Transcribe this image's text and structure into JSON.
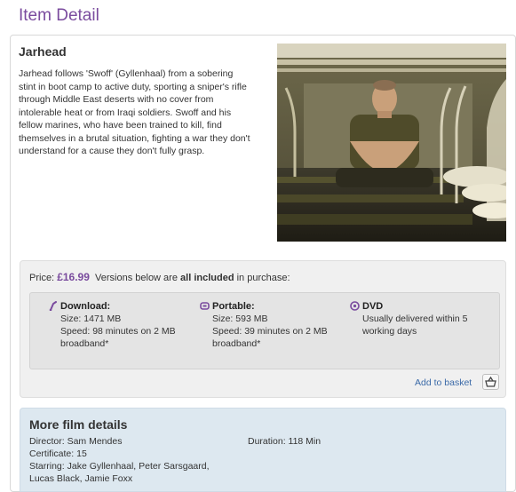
{
  "page": {
    "title": "Item Detail"
  },
  "film": {
    "title": "Jarhead",
    "synopsis": "Jarhead follows 'Swoff' (Gyllenhaal) from a sobering stint in boot camp to active duty, sporting a sniper's rifle through Middle East deserts with no cover from intolerable heat or from Iraqi soldiers. Swoff and his fellow marines, who have been trained to kill, find themselves in a brutal situation, fighting a war they don't understand for a cause they don't fully grasp."
  },
  "purchase": {
    "price_label": "Price:",
    "price_value": "£16.99",
    "versions_pre": "Versions below are",
    "versions_bold": "all included",
    "versions_post": "in purchase:",
    "versions": [
      {
        "icon": "download-icon",
        "title": "Download:",
        "line1": "Size: 1471 MB",
        "line2": "Speed: 98 minutes on 2 MB broadband*"
      },
      {
        "icon": "portable-icon",
        "title": "Portable:",
        "line1": "Size: 593 MB",
        "line2": "Speed: 39 minutes on 2 MB broadband*"
      },
      {
        "icon": "dvd-icon",
        "title": "DVD",
        "line1": "Usually delivered within 5 working days",
        "line2": ""
      }
    ],
    "add_to_basket": "Add to basket",
    "basket_icon": "basket-icon"
  },
  "details": {
    "title": "More film details",
    "director": "Director: Sam Mendes",
    "duration": "Duration: 118 Min",
    "certificate": "Certificate: 15",
    "starring": "Starring: Jake Gyllenhaal, Peter Sarsgaard, Lucas Black, Jamie Foxx"
  },
  "colors": {
    "accent": "#7a4b9e",
    "link": "#3b6aa8",
    "details_bg": "#dde8f0",
    "purchase_bg": "#f0f0f0"
  }
}
